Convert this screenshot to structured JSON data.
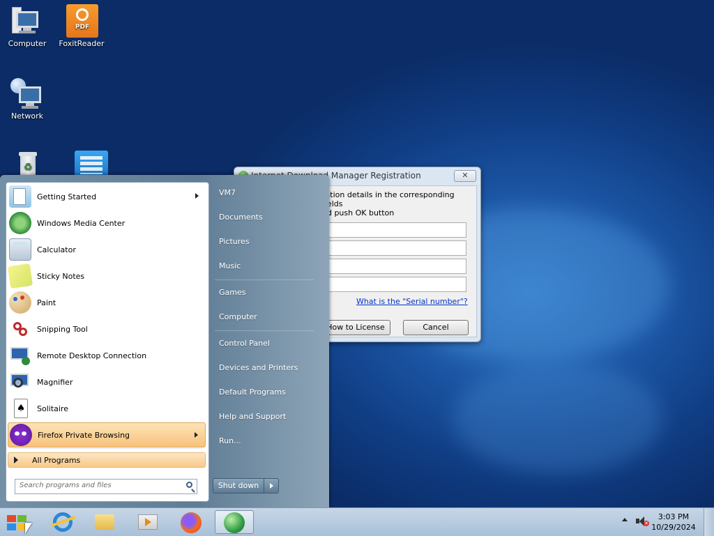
{
  "desktop": {
    "icons": [
      {
        "label": "Computer",
        "icon": "computer-icon"
      },
      {
        "label": "FoxitReader",
        "icon": "pdf-icon"
      },
      {
        "label": "Network",
        "icon": "network-icon"
      },
      {
        "label": "",
        "icon": "recycle-bin-icon"
      },
      {
        "label": "",
        "icon": "app-window-icon"
      }
    ]
  },
  "idm_window": {
    "title": "Internet Download Manager Registration",
    "close_glyph": "✕",
    "instruction_line1": "ration details in the corresponding fields",
    "instruction_line2": "nd push OK button",
    "serial_link": "What is the \"Serial number\"?",
    "how_to_license_label": "How to License",
    "cancel_label": "Cancel",
    "pdf_badge": "PDF"
  },
  "start_menu": {
    "programs": [
      {
        "label": "Getting Started",
        "icon": "getting-started-icon",
        "has_submenu": true
      },
      {
        "label": "Windows Media Center",
        "icon": "media-center-icon"
      },
      {
        "label": "Calculator",
        "icon": "calculator-icon"
      },
      {
        "label": "Sticky Notes",
        "icon": "sticky-notes-icon"
      },
      {
        "label": "Paint",
        "icon": "paint-icon"
      },
      {
        "label": "Snipping Tool",
        "icon": "snipping-tool-icon"
      },
      {
        "label": "Remote Desktop Connection",
        "icon": "remote-desktop-icon"
      },
      {
        "label": "Magnifier",
        "icon": "magnifier-icon"
      },
      {
        "label": "Solitaire",
        "icon": "solitaire-icon"
      },
      {
        "label": "Firefox Private Browsing",
        "icon": "firefox-private-icon",
        "has_submenu": true,
        "selected": true
      }
    ],
    "all_programs_label": "All Programs",
    "search_placeholder": "Search programs and files",
    "right_items": [
      "VM7",
      "Documents",
      "Pictures",
      "Music",
      "Games",
      "Computer",
      "Control Panel",
      "Devices and Printers",
      "Default Programs",
      "Help and Support",
      "Run..."
    ],
    "shutdown_label": "Shut down"
  },
  "taskbar": {
    "items": [
      "start-orb-icon",
      "internet-explorer-icon",
      "file-explorer-icon",
      "media-player-icon",
      "firefox-icon",
      "idm-icon"
    ],
    "time": "3:03 PM",
    "date": "10/29/2024"
  },
  "colors": {
    "desktop_blue": "#1c57a6",
    "menu_highlight": "#f7c27d",
    "link_blue": "#0033cc"
  }
}
